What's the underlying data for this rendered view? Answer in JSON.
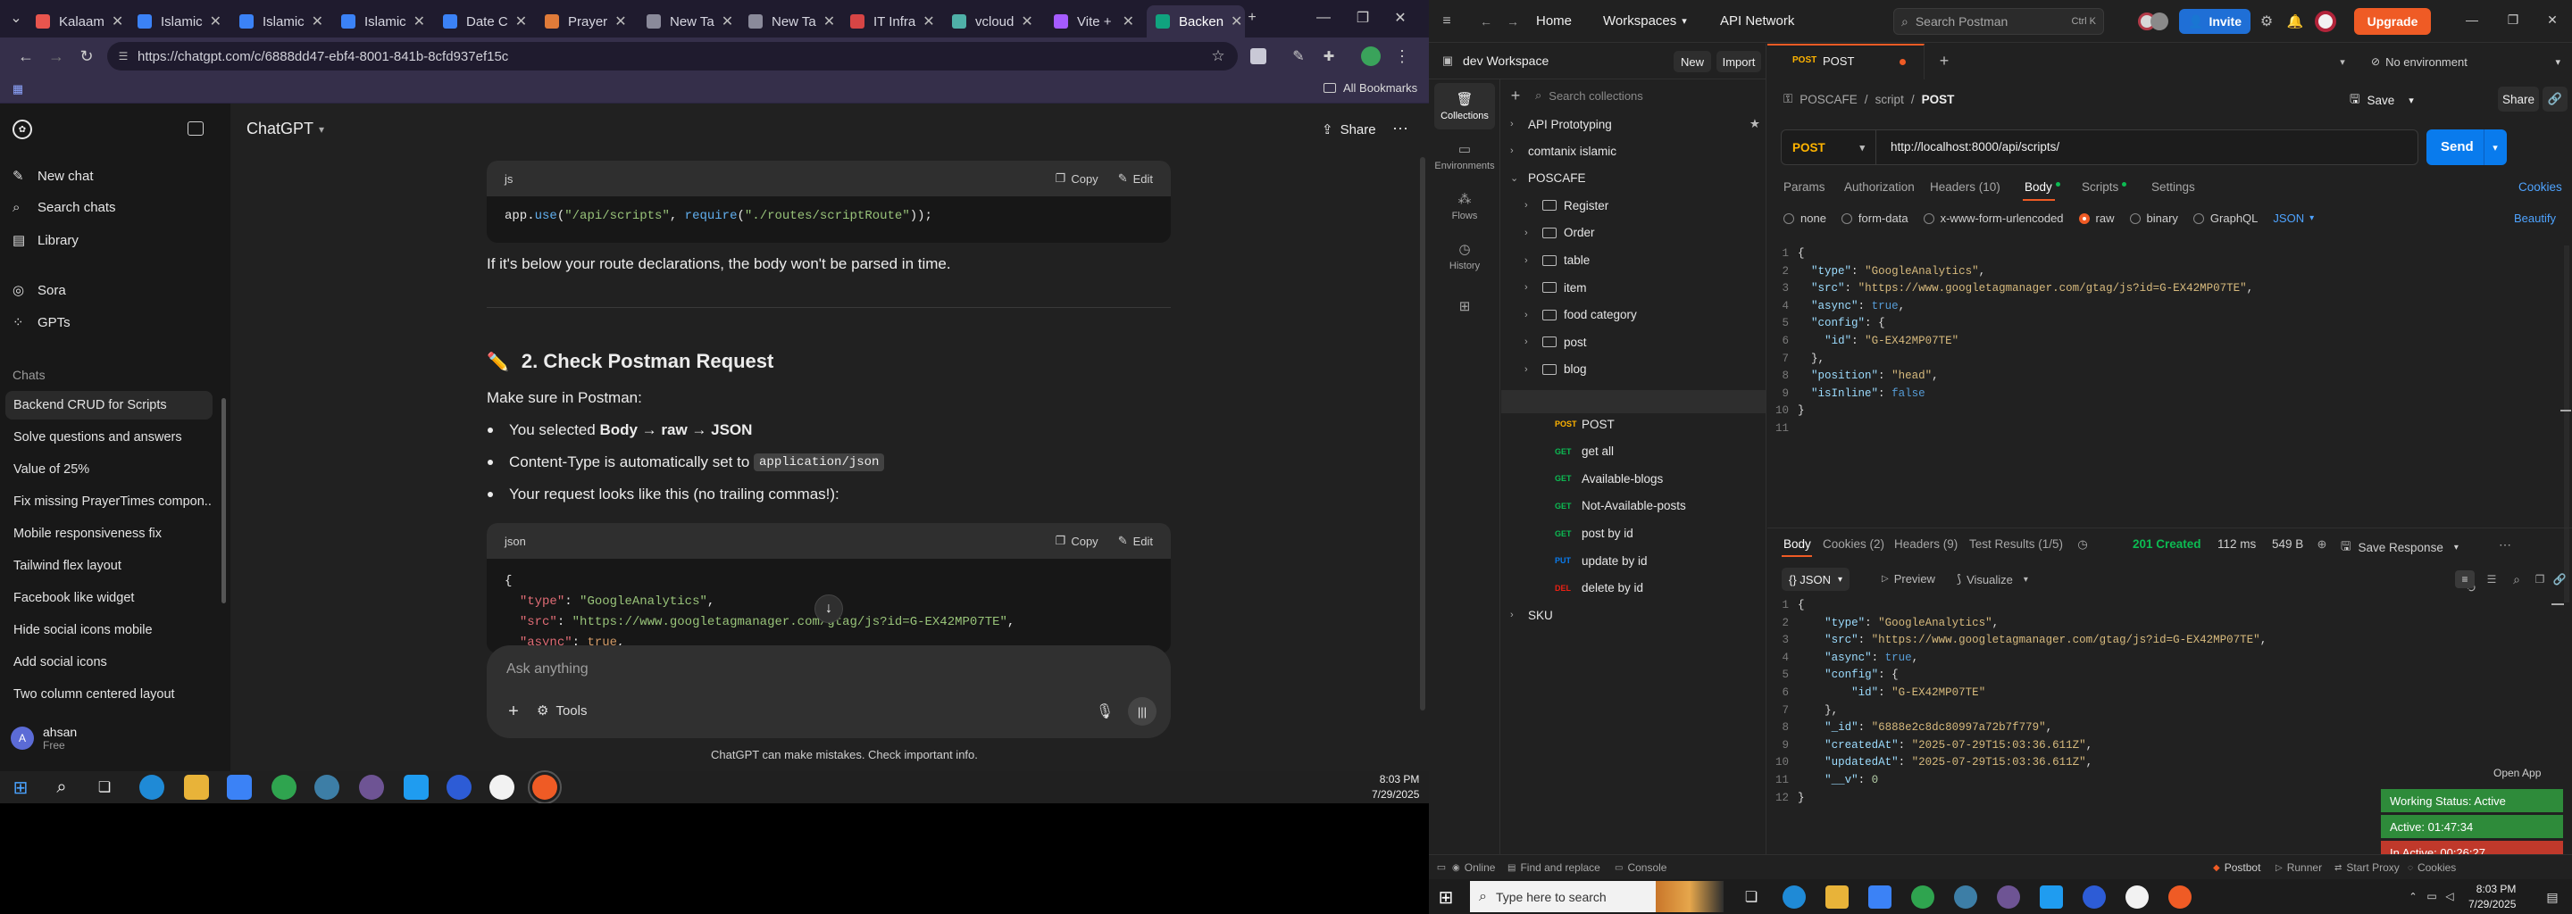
{
  "browser": {
    "tabs": [
      {
        "label": "Kalaam",
        "color": "#e8554e"
      },
      {
        "label": "Islamic",
        "color": "#3b82f6"
      },
      {
        "label": "Islamic",
        "color": "#3b82f6"
      },
      {
        "label": "Islamic",
        "color": "#3b82f6"
      },
      {
        "label": "Date C",
        "color": "#3b82f6"
      },
      {
        "label": "Prayer",
        "color": "#e07b39"
      },
      {
        "label": "New Ta",
        "color": "#8a8a9a"
      },
      {
        "label": "New Ta",
        "color": "#8a8a9a"
      },
      {
        "label": "IT Infra",
        "color": "#d64545"
      },
      {
        "label": "vcloud",
        "color": "#4fb0a8"
      },
      {
        "label": "Vite +",
        "color": "#a55bff"
      },
      {
        "label": "Backen",
        "color": "#10a37f"
      }
    ],
    "url": "https://chatgpt.com/c/6888dd47-ebf4-8001-841b-8cfd937ef15c",
    "all_bookmarks": "All Bookmarks"
  },
  "chatgpt": {
    "sidebar": {
      "new_chat": "New chat",
      "search_chats": "Search chats",
      "library": "Library",
      "sora": "Sora",
      "gpts": "GPTs",
      "chats_heading": "Chats",
      "chats": [
        "Backend CRUD for Scripts",
        "Solve questions and answers",
        "Value of 25%",
        "Fix missing PrayerTimes compon...",
        "Mobile responsiveness fix",
        "Tailwind flex layout",
        "Facebook like widget",
        "Hide social icons mobile",
        "Add social icons",
        "Two column centered layout"
      ],
      "user_initial": "A",
      "user_name": "ahsan",
      "user_plan": "Free"
    },
    "header": {
      "model": "ChatGPT",
      "share": "Share"
    },
    "code1": {
      "lang": "js",
      "copy": "Copy",
      "edit": "Edit"
    },
    "route_note": "If it's below your route declarations, the body won't be parsed in time.",
    "section_icon": "✏️",
    "section_title": "2. Check Postman Request",
    "make_sure": "Make sure in Postman:",
    "b1_pre": "You selected ",
    "b1_bold": "Body → raw → JSON",
    "b2_pre": "Content-Type is automatically set to ",
    "b2_code": "application/json",
    "b3": "Your request looks like this (no trailing commas!):",
    "code2": {
      "lang": "json",
      "copy": "Copy",
      "edit": "Edit"
    },
    "composer_placeholder": "Ask anything",
    "tools": "Tools",
    "disclaimer": "ChatGPT can make mistakes. Check important info."
  },
  "left_taskbar": {
    "time": "8:03 PM",
    "date": "7/29/2025"
  },
  "postman": {
    "nav": {
      "home": "Home",
      "workspaces": "Workspaces",
      "api_network": "API Network",
      "search": "Search Postman",
      "shortcut": "Ctrl K",
      "invite": "Invite",
      "upgrade": "Upgrade"
    },
    "workspace": {
      "name": "dev Workspace",
      "new": "New",
      "import": "Import"
    },
    "rail": [
      "Collections",
      "Environments",
      "Flows",
      "History"
    ],
    "search_collections": "Search collections",
    "collections": [
      {
        "name": "API Prototyping",
        "starred": true
      },
      {
        "name": "comtanix islamic"
      },
      {
        "name": "POSCAFE",
        "open": true
      }
    ],
    "folders": [
      "Register",
      "Order",
      "table",
      "item",
      "food category",
      "post",
      "blog"
    ],
    "script_folder": "script",
    "requests": [
      {
        "method": "POST",
        "name": "POST",
        "color": "#ffb400"
      },
      {
        "method": "GET",
        "name": "get all",
        "color": "#0cbb52"
      },
      {
        "method": "GET",
        "name": "Available-blogs",
        "color": "#0cbb52"
      },
      {
        "method": "GET",
        "name": "Not-Available-posts",
        "color": "#0cbb52"
      },
      {
        "method": "GET",
        "name": "post by id",
        "color": "#0cbb52"
      },
      {
        "method": "PUT",
        "name": "update by id",
        "color": "#097bed"
      },
      {
        "method": "DEL",
        "name": "delete by id",
        "color": "#eb2013"
      }
    ],
    "sku": "SKU",
    "tab": {
      "method": "POST",
      "name": "POST"
    },
    "no_env": "No environment",
    "breadcrumb": {
      "coll": "POSCAFE",
      "folder": "script",
      "req": "POST"
    },
    "save": "Save",
    "share": "Share",
    "method": "POST",
    "url": "http://localhost:8000/api/scripts/",
    "send": "Send",
    "req_tabs": {
      "params": "Params",
      "auth": "Authorization",
      "headers": "Headers (10)",
      "body": "Body",
      "scripts": "Scripts",
      "settings": "Settings",
      "cookies": "Cookies"
    },
    "body_modes": {
      "none": "none",
      "form": "form-data",
      "url": "x-www-form-urlencoded",
      "raw": "raw",
      "binary": "binary",
      "graphql": "GraphQL",
      "json": "JSON",
      "beautify": "Beautify"
    },
    "req_body": [
      "{",
      "  \"type\": \"GoogleAnalytics\",",
      "  \"src\": \"https://www.googletagmanager.com/gtag/js?id=G-EX42MP07TE\",",
      "  \"async\": true,",
      "  \"config\": {",
      "    \"id\": \"G-EX42MP07TE\"",
      "  },",
      "  \"position\": \"head\",",
      "  \"isInline\": false",
      "}",
      ""
    ],
    "resp_tabs": {
      "body": "Body",
      "cookies": "Cookies (2)",
      "headers": "Headers (9)",
      "tests": "Test Results (1/5)"
    },
    "status": "201 Created",
    "time": "112 ms",
    "size": "549 B",
    "save_response": "Save Response",
    "resp_format": "{} JSON",
    "preview": "Preview",
    "visualize": "Visualize",
    "resp_body": [
      "{",
      "    \"type\": \"GoogleAnalytics\",",
      "    \"src\": \"https://www.googletagmanager.com/gtag/js?id=G-EX42MP07TE\",",
      "    \"async\": true,",
      "    \"config\": {",
      "        \"id\": \"G-EX42MP07TE\"",
      "    },",
      "    \"_id\": \"6888e2c8dc80997a72b7f779\",",
      "    \"createdAt\": \"2025-07-29T15:03:36.611Z\",",
      "    \"updatedAt\": \"2025-07-29T15:03:36.611Z\",",
      "    \"__v\": 0",
      "}"
    ],
    "statusbar": {
      "online": "Online",
      "find": "Find and replace",
      "console": "Console",
      "postbot": "Postbot",
      "runner": "Runner",
      "proxy": "Start Proxy",
      "cookies": "Cookies"
    },
    "open_app": "Open App",
    "badges": [
      {
        "label": "Working Status: Active",
        "color": "#2e8b3a"
      },
      {
        "label": "Active: 01:47:34",
        "color": "#2e8b3a"
      },
      {
        "label": "In Active: 00:26:27",
        "color": "#c0392b"
      }
    ],
    "taskbar": {
      "search": "Type here to search",
      "time": "8:03 PM",
      "date": "7/29/2025"
    }
  }
}
